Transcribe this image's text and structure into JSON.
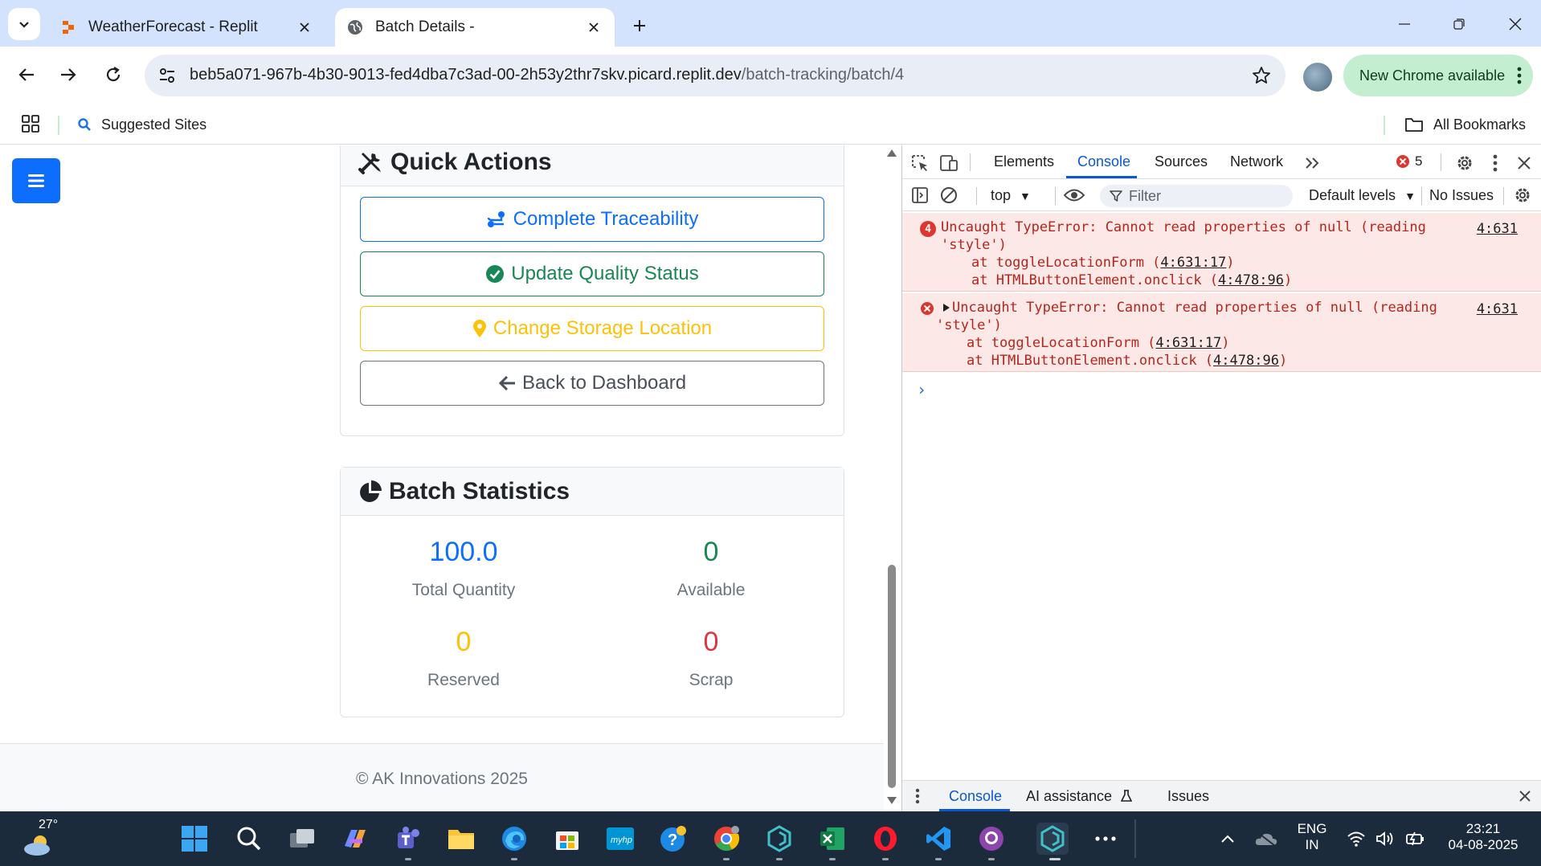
{
  "browser": {
    "tabs": [
      {
        "title": "WeatherForecast - Replit",
        "active": false
      },
      {
        "title": "Batch Details -",
        "active": true
      }
    ],
    "url_host": "beb5a071-967b-4b30-9013-fed4dba7c3ad-00-2h53y2thr7skv.picard.replit.dev",
    "url_path": "/batch-tracking/batch/4",
    "update_label": "New Chrome available",
    "bookmarks": {
      "suggested": "Suggested Sites",
      "all": "All Bookmarks"
    }
  },
  "page": {
    "quick_actions": {
      "title": "Quick Actions",
      "buttons": [
        {
          "label": "Complete Traceability",
          "color": "#0d6efd"
        },
        {
          "label": "Update Quality Status",
          "color": "#198754"
        },
        {
          "label": "Change Storage Location",
          "color": "#ffc107"
        },
        {
          "label": "Back to Dashboard",
          "color": "#495057"
        }
      ]
    },
    "batch_statistics": {
      "title": "Batch Statistics",
      "stats": [
        {
          "value": "100.0",
          "label": "Total Quantity",
          "color": "#0d6efd"
        },
        {
          "value": "0",
          "label": "Available",
          "color": "#198754"
        },
        {
          "value": "0",
          "label": "Reserved",
          "color": "#ffc107"
        },
        {
          "value": "0",
          "label": "Scrap",
          "color": "#dc3545"
        }
      ]
    },
    "footer": "© AK Innovations 2025"
  },
  "devtools": {
    "tabs": [
      "Elements",
      "Console",
      "Sources",
      "Network"
    ],
    "active_tab": "Console",
    "error_count": "5",
    "context": "top",
    "filter_placeholder": "Filter",
    "levels": "Default levels",
    "issues": "No Issues",
    "messages": [
      {
        "repeat": "4",
        "line1": "Uncaught TypeError: Cannot read properties of null (reading",
        "line2": "'style')",
        "frame1_prefix": "at toggleLocationForm (",
        "frame1_link": "4:631:17",
        "frame2_prefix": "at HTMLButtonElement.onclick (",
        "frame2_link": "4:478:96",
        "source": "4:631"
      },
      {
        "line1": "Uncaught TypeError: Cannot read properties of null (reading",
        "line2": "'style')",
        "frame1_prefix": "at toggleLocationForm (",
        "frame1_link": "4:631:17",
        "frame2_prefix": "at HTMLButtonElement.onclick (",
        "frame2_link": "4:478:96",
        "source": "4:631"
      }
    ],
    "drawer_tabs": [
      "Console",
      "AI assistance",
      "Issues"
    ]
  },
  "taskbar": {
    "temperature": "27°",
    "language": "ENG",
    "region": "IN",
    "time": "23:21",
    "date": "04-08-2025"
  }
}
